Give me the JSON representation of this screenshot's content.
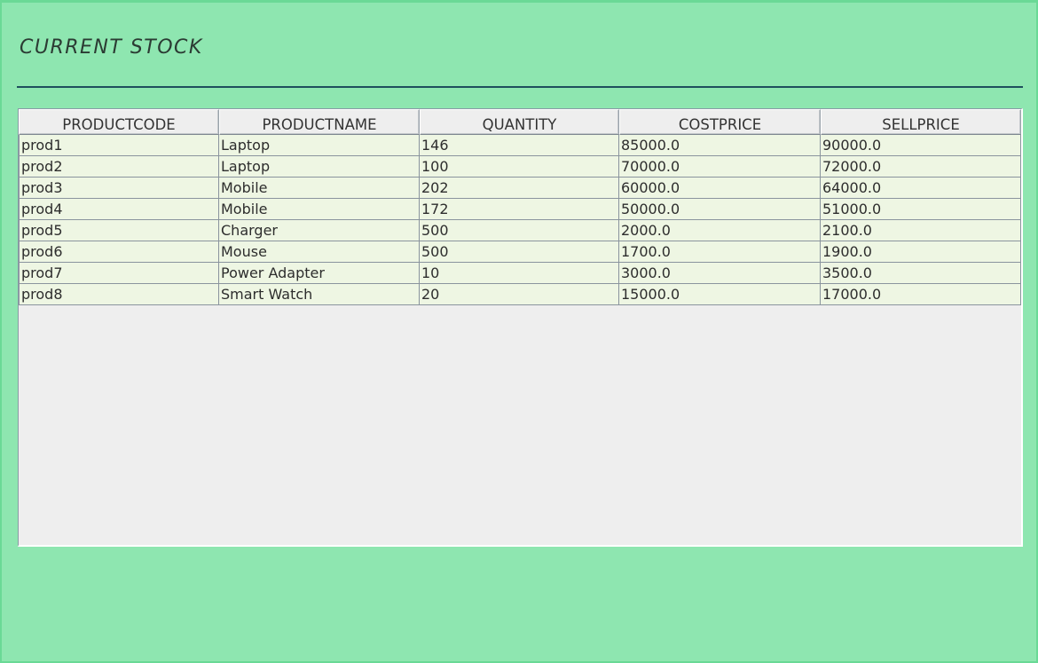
{
  "window": {
    "title": "CURRENT STOCK"
  },
  "table": {
    "columns": [
      "PRODUCTCODE",
      "PRODUCTNAME",
      "QUANTITY",
      "COSTPRICE",
      "SELLPRICE"
    ],
    "rows": [
      [
        "prod1",
        "Laptop",
        "146",
        "85000.0",
        "90000.0"
      ],
      [
        "prod2",
        "Laptop",
        "100",
        "70000.0",
        "72000.0"
      ],
      [
        "prod3",
        "Mobile",
        "202",
        "60000.0",
        "64000.0"
      ],
      [
        "prod4",
        "Mobile",
        "172",
        "50000.0",
        "51000.0"
      ],
      [
        "prod5",
        "Charger",
        "500",
        "2000.0",
        "2100.0"
      ],
      [
        "prod6",
        "Mouse",
        "500",
        "1700.0",
        "1900.0"
      ],
      [
        "prod7",
        "Power Adapter",
        "10",
        "3000.0",
        "3500.0"
      ],
      [
        "prod8",
        "Smart Watch",
        "20",
        "15000.0",
        "17000.0"
      ]
    ]
  },
  "colors": {
    "background": "#8ee6b0",
    "rule": "#1f4f5c",
    "row_background": "#eef6e3",
    "table_background": "#eeeeee"
  }
}
